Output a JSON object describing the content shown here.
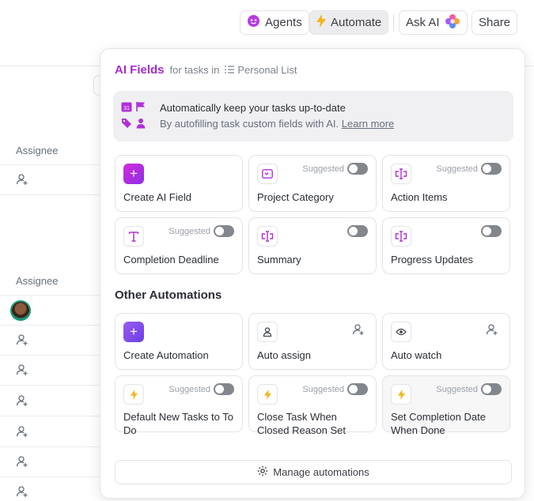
{
  "toolbar": {
    "agents_label": "Agents",
    "automate_label": "Automate",
    "ask_ai_label": "Ask AI",
    "share_label": "Share"
  },
  "background": {
    "column_header_1": "Assignee",
    "column_header_2": "Assignee"
  },
  "panel": {
    "title": "AI Fields",
    "subtitle": "for tasks in",
    "list_name": "Personal List",
    "banner": {
      "line1": "Automatically keep your tasks up-to-date",
      "line2": "By autofilling task custom fields with AI.",
      "link": "Learn more",
      "calendar_number": "31"
    },
    "ai_fields": [
      {
        "label": "Create AI Field",
        "icon": "plus-icon"
      },
      {
        "label": "Project Category",
        "icon": "dropdown-field-icon",
        "suggested": "Suggested",
        "enabled": false
      },
      {
        "label": "Action Items",
        "icon": "ai-field-icon",
        "suggested": "Suggested",
        "enabled": false
      },
      {
        "label": "Completion Deadline",
        "icon": "text-field-icon",
        "suggested": "Suggested",
        "enabled": false
      },
      {
        "label": "Summary",
        "icon": "ai-field-icon",
        "enabled": false
      },
      {
        "label": "Progress Updates",
        "icon": "ai-field-icon",
        "enabled": false
      }
    ],
    "other_title": "Other Automations",
    "automations": [
      {
        "label": "Create Automation",
        "icon": "plus-icon"
      },
      {
        "label": "Auto assign",
        "icon": "user-icon"
      },
      {
        "label": "Auto watch",
        "icon": "eye-icon"
      },
      {
        "label": "Default New Tasks to To Do",
        "icon": "lightning-icon",
        "suggested": "Suggested",
        "enabled": false
      },
      {
        "label": "Close Task When Closed Reason Set",
        "icon": "lightning-icon",
        "suggested": "Suggested",
        "enabled": false
      },
      {
        "label": "Set Completion Date When Done",
        "icon": "lightning-icon",
        "suggested": "Suggested",
        "enabled": false
      }
    ],
    "manage_label": "Manage automations"
  },
  "colors": {
    "accent_purple": "#a12ed0",
    "lightning_yellow": "#f2b61b"
  }
}
